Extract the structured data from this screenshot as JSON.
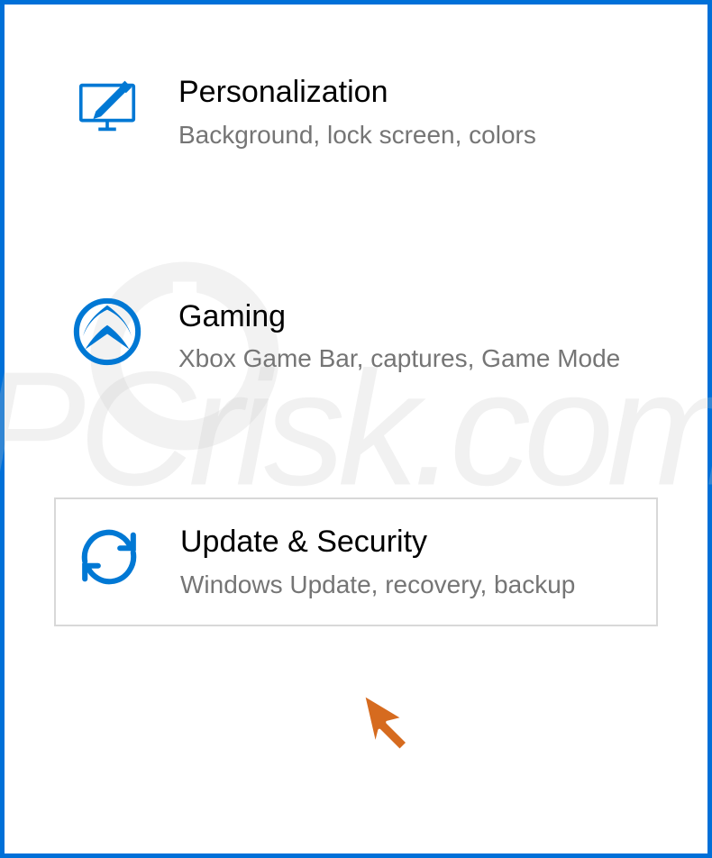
{
  "settings": {
    "items": [
      {
        "title": "Personalization",
        "description": "Background, lock screen, colors"
      },
      {
        "title": "Gaming",
        "description": "Xbox Game Bar, captures, Game Mode"
      },
      {
        "title": "Update & Security",
        "description": "Windows Update, recovery, backup"
      }
    ]
  },
  "watermark": {
    "text": "PCrisk.com"
  }
}
